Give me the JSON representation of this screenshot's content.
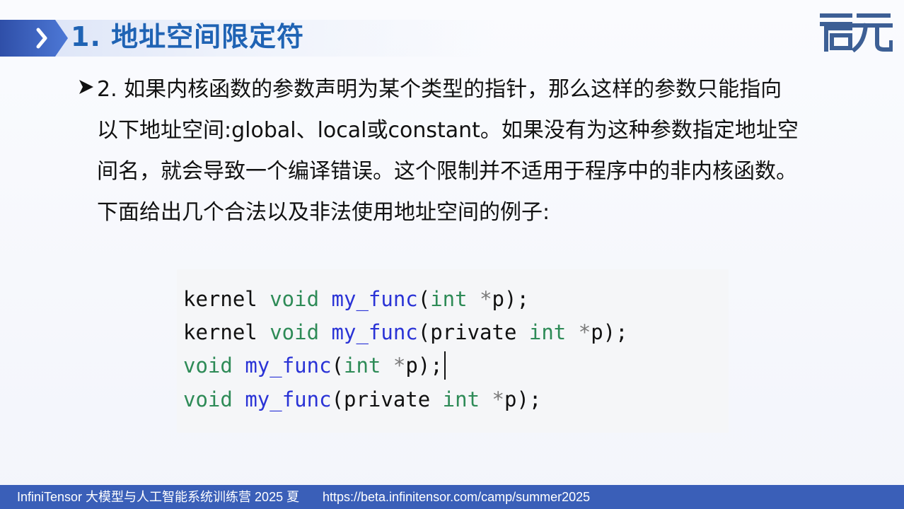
{
  "header": {
    "title": "1. 地址空间限定符",
    "logo_text": "启元"
  },
  "content": {
    "bullet_icon": "arrow-bullet-icon",
    "lines": [
      "2.  如果内核函数的参数声明为某个类型的指针，那么这样的参数只能指向",
      "以下地址空间:global、local或constant。如果没有为这种参数指定地址空",
      "间名，就会导致一个编译错误。这个限制并不适用于程序中的非内核函数。",
      "下面给出几个合法以及非法使用地址空间的例子:"
    ]
  },
  "code": {
    "lines": [
      [
        {
          "t": "kernel ",
          "c": "plain"
        },
        {
          "t": "void ",
          "c": "type"
        },
        {
          "t": "my_func",
          "c": "func"
        },
        {
          "t": "(",
          "c": "plain"
        },
        {
          "t": "int ",
          "c": "type"
        },
        {
          "t": "*",
          "c": "op"
        },
        {
          "t": "p);",
          "c": "plain"
        }
      ],
      [
        {
          "t": "kernel ",
          "c": "plain"
        },
        {
          "t": "void ",
          "c": "type"
        },
        {
          "t": "my_func",
          "c": "func"
        },
        {
          "t": "(private ",
          "c": "plain"
        },
        {
          "t": "int ",
          "c": "type"
        },
        {
          "t": "*",
          "c": "op"
        },
        {
          "t": "p);",
          "c": "plain"
        }
      ],
      [
        {
          "t": "void ",
          "c": "type"
        },
        {
          "t": "my_func",
          "c": "func"
        },
        {
          "t": "(",
          "c": "plain"
        },
        {
          "t": "int ",
          "c": "type"
        },
        {
          "t": "*",
          "c": "op"
        },
        {
          "t": "p);",
          "c": "plain"
        }
      ],
      [
        {
          "t": "void ",
          "c": "type"
        },
        {
          "t": "my_func",
          "c": "func"
        },
        {
          "t": "(private ",
          "c": "plain"
        },
        {
          "t": "int ",
          "c": "type"
        },
        {
          "t": "*",
          "c": "op"
        },
        {
          "t": "p);",
          "c": "plain"
        }
      ]
    ]
  },
  "footer": {
    "course": "InfiniTensor 大模型与人工智能系统训练营 2025 夏",
    "url": "https://beta.infinitensor.com/camp/summer2025"
  },
  "colors": {
    "title": "#1f63b4",
    "footer_bg": "#3a5fb8",
    "code_type": "#2e8b57",
    "code_func": "#2a33d6",
    "logo": "#3d5f95"
  }
}
